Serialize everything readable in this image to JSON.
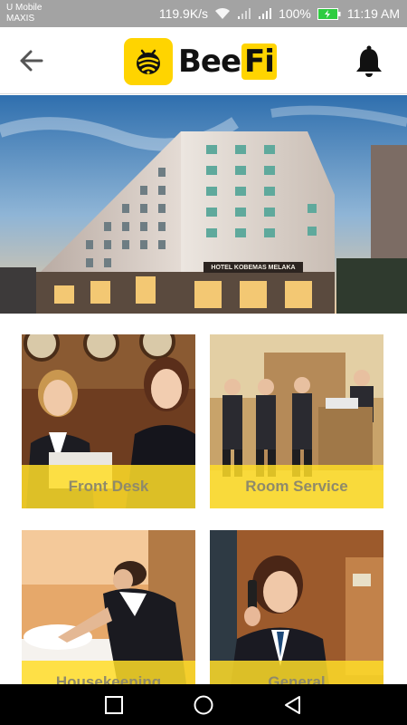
{
  "status_bar": {
    "carrier_line1": "U Mobile",
    "carrier_line2": "MAXIS",
    "network_speed": "119.9K/s",
    "battery_percent": "100%",
    "time": "11:19 AM"
  },
  "app_bar": {
    "logo_text_bee": "Bee",
    "logo_text_fi": "Fi",
    "back_icon": "arrow-left-icon",
    "notification_icon": "bell-icon"
  },
  "hero": {
    "sign_text": "HOTEL KOBEMAS MELAKA"
  },
  "services": [
    {
      "label": "Front Desk"
    },
    {
      "label": "Room Service"
    },
    {
      "label": "Housekeeping"
    },
    {
      "label": "General"
    }
  ],
  "colors": {
    "brand_yellow": "#ffd400",
    "status_bar_bg": "#a3a3a3",
    "nav_bar_bg": "#000000",
    "label_text": "#8f8a6a"
  }
}
